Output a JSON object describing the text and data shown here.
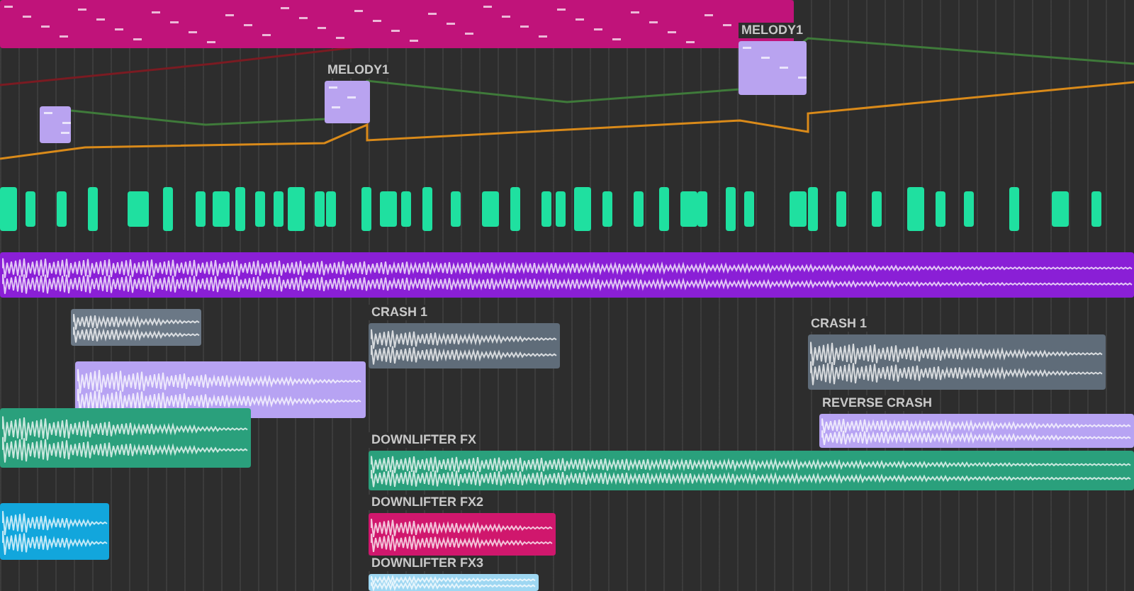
{
  "arrangement": {
    "clips": [
      {
        "kind": "midi",
        "color": "#c0137a"
      },
      {
        "kind": "midi",
        "color": "#b9a3f0"
      },
      {
        "kind": "midi",
        "color": "#b9a3f0",
        "label": "MELODY1"
      },
      {
        "kind": "midi",
        "color": "#b9a3f0",
        "label": "MELODY1"
      },
      {
        "kind": "drum",
        "color": "#1fe0a0"
      },
      {
        "kind": "audio",
        "color": "#8a1fd6"
      },
      {
        "kind": "audio",
        "color": "#6b7886"
      },
      {
        "kind": "audio",
        "color": "#5f6c79",
        "label": "CRASH 1"
      },
      {
        "kind": "audio",
        "color": "#5f6c79",
        "label": "CRASH 1"
      },
      {
        "kind": "audio",
        "color": "#b7a3f3"
      },
      {
        "kind": "audio",
        "color": "#2aa07c"
      },
      {
        "kind": "audio",
        "color": "#b7a3f3",
        "label": "REVERSE CRASH"
      },
      {
        "kind": "audio",
        "color": "#2aa07c",
        "label": "DOWNLIFTER FX"
      },
      {
        "kind": "audio",
        "color": "#12a6dc"
      },
      {
        "kind": "audio",
        "color": "#d0176d",
        "label": "DOWNLIFTER FX2"
      },
      {
        "kind": "audio",
        "color": "#9ed7f2",
        "label": "DOWNLIFTER FX3"
      }
    ]
  }
}
